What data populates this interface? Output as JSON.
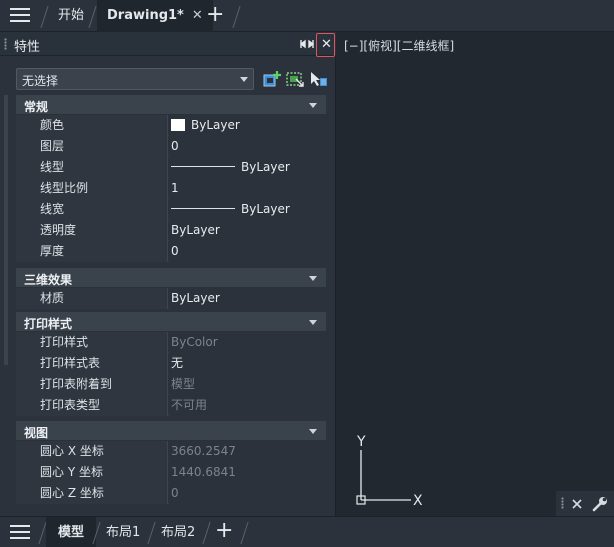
{
  "top_tabs": {
    "start_label": "开始",
    "drawing_label": "Drawing1*",
    "close_glyph": "✕",
    "new_tab_glyph": "+"
  },
  "panel": {
    "title": "特性",
    "close_glyph": "✕",
    "selector_value": "无选择",
    "categories": [
      {
        "label": "常规",
        "rows": [
          {
            "key": "颜色",
            "value": "ByLayer"
          },
          {
            "key": "图层",
            "value": "0"
          },
          {
            "key": "线型",
            "value": "ByLayer"
          },
          {
            "key": "线型比例",
            "value": "1"
          },
          {
            "key": "线宽",
            "value": "ByLayer"
          },
          {
            "key": "透明度",
            "value": "ByLayer"
          },
          {
            "key": "厚度",
            "value": "0"
          }
        ]
      },
      {
        "label": "三维效果",
        "rows": [
          {
            "key": "材质",
            "value": "ByLayer"
          }
        ]
      },
      {
        "label": "打印样式",
        "rows": [
          {
            "key": "打印样式",
            "value": "ByColor"
          },
          {
            "key": "打印样式表",
            "value": "无"
          },
          {
            "key": "打印表附着到",
            "value": "模型"
          },
          {
            "key": "打印表类型",
            "value": "不可用"
          }
        ]
      },
      {
        "label": "视图",
        "rows": [
          {
            "key": "圆心 X 坐标",
            "value": "3660.2547"
          },
          {
            "key": "圆心 Y 坐标",
            "value": "1440.6841"
          },
          {
            "key": "圆心 Z 坐标",
            "value": "0"
          }
        ]
      }
    ]
  },
  "viewport": {
    "label": "[−][俯视][二维线框]",
    "axis_x": "X",
    "axis_y": "Y"
  },
  "bottom_tabs": {
    "model_label": "模型",
    "layout1_label": "布局1",
    "layout2_label": "布局2",
    "new_tab_glyph": "+"
  },
  "colors": {
    "background": "#212830",
    "panel": "#2b323b",
    "highlight_border": "#e0545c"
  }
}
